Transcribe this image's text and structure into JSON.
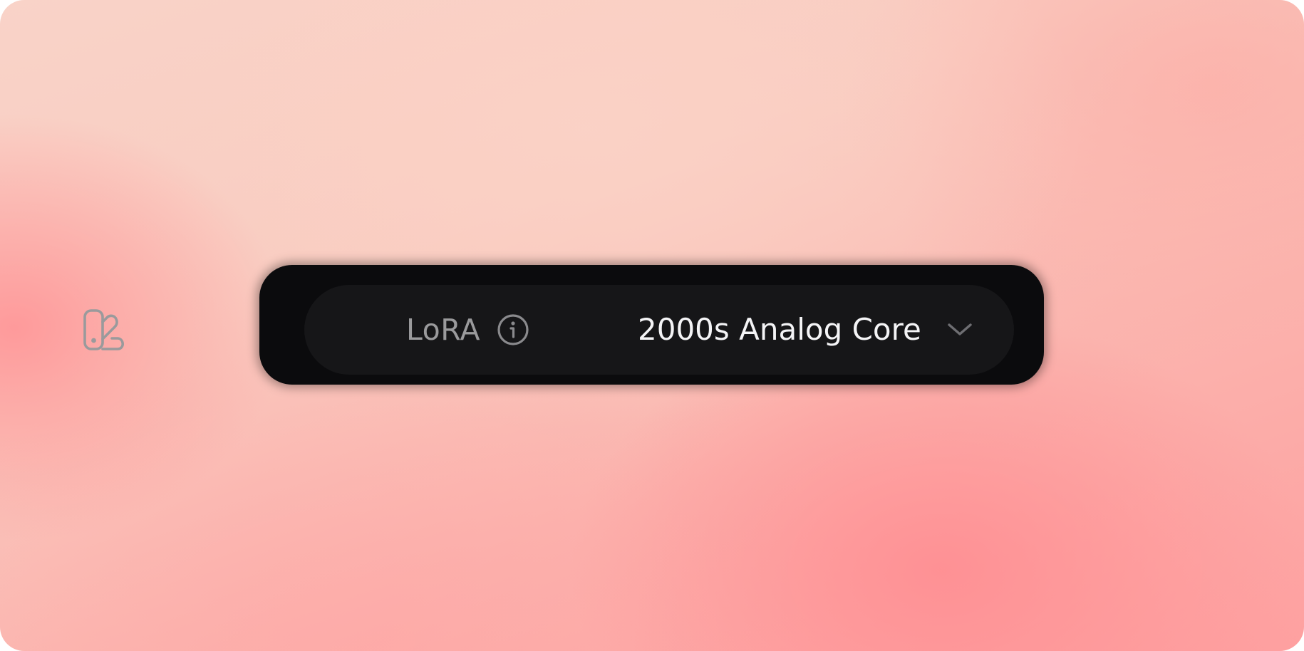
{
  "lora_selector": {
    "label": "LoRA",
    "selected_value": "2000s Analog Core",
    "icons": {
      "leading": "swatch-palette-icon",
      "info": "info-icon",
      "expand": "chevron-down-icon"
    }
  },
  "colors": {
    "panel_background": "#0b0b0d",
    "pill_background": "#161618",
    "label_text": "#9a9a9c",
    "value_text": "#f4f4f6",
    "icon_stroke": "#9a9a9c",
    "chevron_stroke": "#6e6e72"
  }
}
